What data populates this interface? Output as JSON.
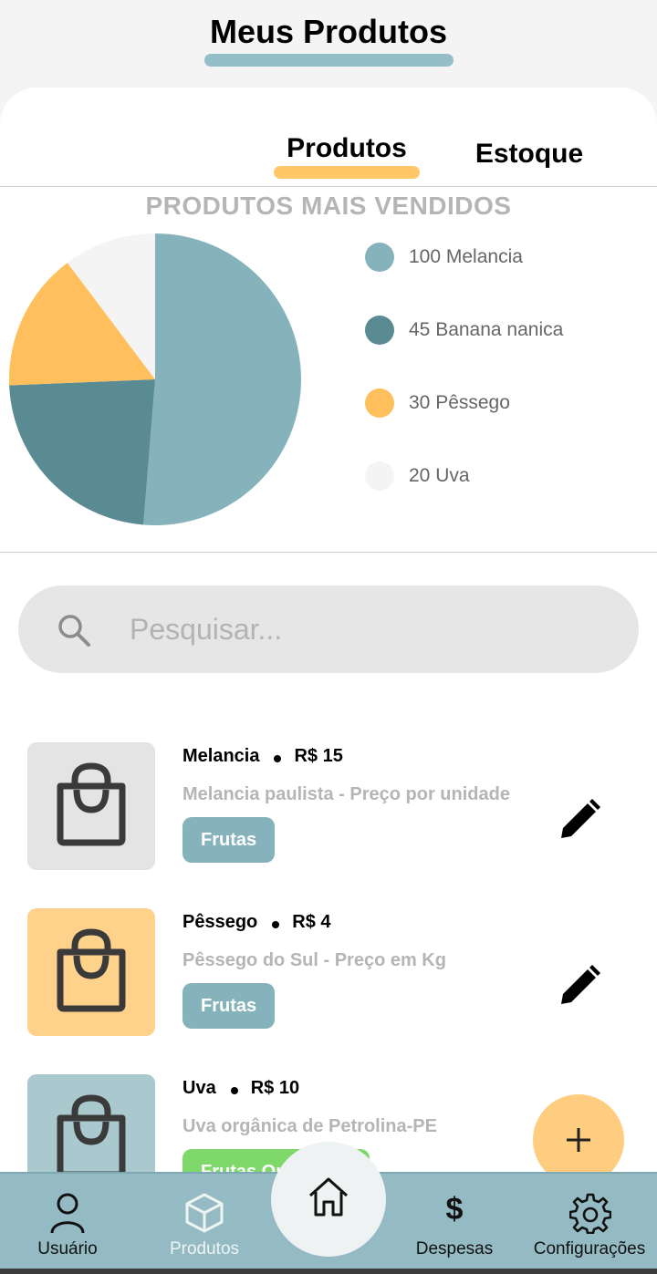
{
  "header": {
    "title": "Meus Produtos"
  },
  "tabs": [
    {
      "label": "Produtos",
      "active": true
    },
    {
      "label": "Estoque",
      "active": false
    }
  ],
  "chart_data": {
    "type": "pie",
    "title": "PRODUTOS MAIS VENDIDOS",
    "categories": [
      "Melancia",
      "Banana nanica",
      "Pêssego",
      "Uva"
    ],
    "values": [
      100,
      45,
      30,
      20
    ],
    "colors": [
      "#86b3bb",
      "#5b8b92",
      "#ffbf5c",
      "#f4f4f4"
    ],
    "legend_labels": [
      "100 Melancia",
      "45 Banana nanica",
      "30 Pêssego",
      "20 Uva"
    ],
    "legend_position": "right"
  },
  "search": {
    "placeholder": "Pesquisar...",
    "value": "",
    "icon": "search-icon"
  },
  "products": [
    {
      "name": "Melancia",
      "price": "R$ 15",
      "description": "Melancia paulista - Preço por unidade",
      "tag": "Frutas",
      "tag_color": "#86b3bb",
      "thumb_color": "#e4e4e4",
      "icon": "shopping-bag-icon"
    },
    {
      "name": "Pêssego",
      "price": "R$ 4",
      "description": "Pêssego do Sul - Preço em Kg",
      "tag": "Frutas",
      "tag_color": "#86b3bb",
      "thumb_color": "#ffd28c",
      "icon": "shopping-bag-icon"
    },
    {
      "name": "Uva",
      "price": "R$ 10",
      "description": "Uva orgânica de Petrolina-PE",
      "tag": "Frutas Orgânicas",
      "tag_color": "#7fd86a",
      "thumb_color": "#a9c9cf",
      "icon": "shopping-bag-icon"
    }
  ],
  "fab": {
    "icon": "plus-icon",
    "color": "#ffcd80"
  },
  "nav": {
    "items": [
      {
        "label": "Usuário",
        "icon": "user-icon"
      },
      {
        "label": "Produtos",
        "icon": "box-icon",
        "active": true
      },
      {
        "label": "",
        "icon": "home-icon"
      },
      {
        "label": "Despesas",
        "icon": "dollar-icon"
      },
      {
        "label": "Configurações",
        "icon": "gear-icon"
      }
    ]
  },
  "colors": {
    "accent": "#94bfc8",
    "tab_indicator": "#ffc768",
    "nav_bg": "#94bbc3"
  }
}
